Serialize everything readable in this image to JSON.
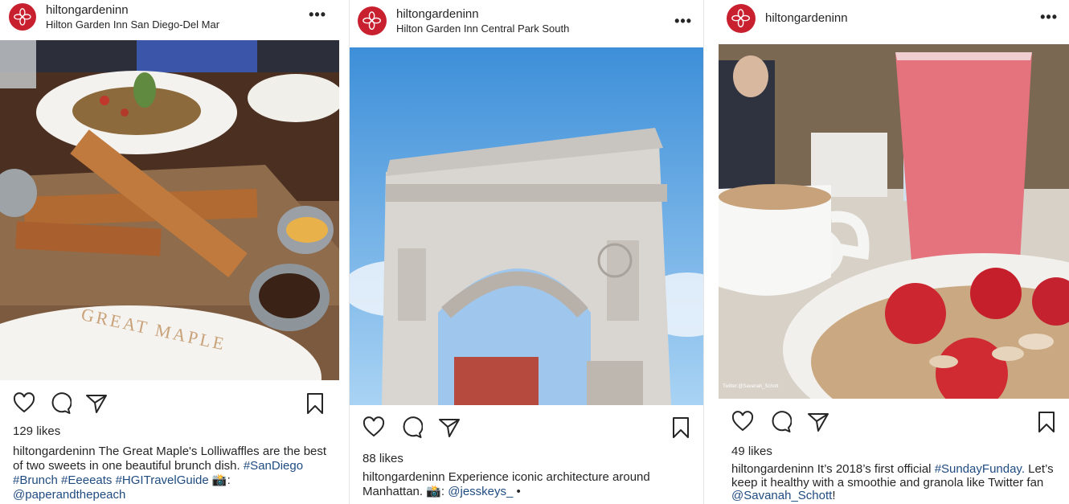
{
  "posts": [
    {
      "username": "hiltongardeninn",
      "location": "Hilton Garden Inn San Diego-Del Mar",
      "likes": "129 likes",
      "caption_user": "hiltongardeninn",
      "caption_text": "The Great Maple's Lolliwaffles are the best of two sweets in one beautiful brunch dish.",
      "hashtags": "#SanDiego #Brunch #Eeeeats #HGITravelGuide",
      "camera": "📸:",
      "mention": "@paperandthepeach",
      "plate_text": "GREAT MAPLE"
    },
    {
      "username": "hiltongardeninn",
      "location": "Hilton Garden Inn Central Park South",
      "likes": "88 likes",
      "caption_user": "hiltongardeninn",
      "caption_text": "Experience iconic architecture around Manhattan.",
      "camera": "📸:",
      "mention": "@jesskeys_",
      "suffix": "•"
    },
    {
      "username": "hiltongardeninn",
      "likes": "49 likes",
      "caption_user": "hiltongardeninn",
      "caption_text_1": "It’s 2018’s first official",
      "hashtag": "#SundayFunday.",
      "caption_text_2": "Let’s keep it healthy with a smoothie and granola like Twitter fan",
      "mention": "@Savanah_Schott",
      "suffix": "!",
      "photo_credit": "Twitter:@Savanah_Schott"
    }
  ],
  "icons": [
    "heart-icon",
    "comment-icon",
    "share-icon",
    "bookmark-icon",
    "more-icon"
  ],
  "colors": {
    "brand_red": "#c8202e",
    "link_blue": "#1f4b80",
    "text": "#262626"
  }
}
